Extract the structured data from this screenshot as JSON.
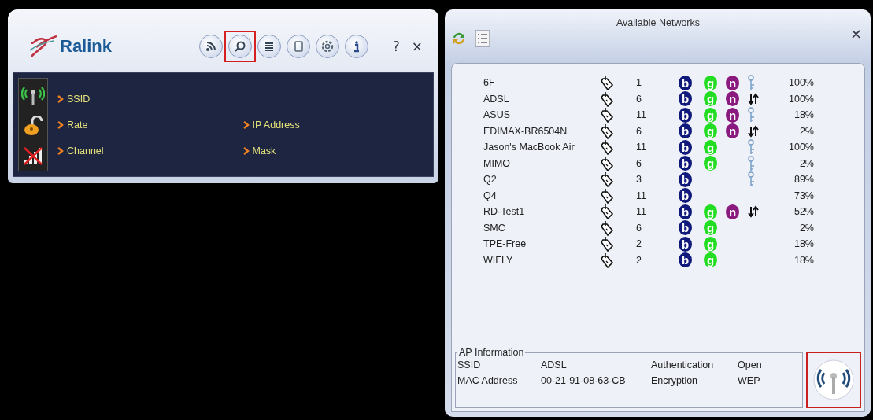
{
  "main_window": {
    "logo": "Ralink",
    "toolbar": [
      {
        "kind": "rss",
        "highlighted": false
      },
      {
        "kind": "search",
        "highlighted": true
      },
      {
        "kind": "list",
        "highlighted": false
      },
      {
        "kind": "page",
        "highlighted": false
      },
      {
        "kind": "gear",
        "highlighted": false
      },
      {
        "kind": "info",
        "highlighted": false
      }
    ],
    "help": "?",
    "close": "×",
    "fields_left": [
      "SSID",
      "Rate",
      "Channel"
    ],
    "fields_right": [
      "IP Address",
      "Mask"
    ]
  },
  "networks_window": {
    "title": "Available Networks",
    "close": "×",
    "networks": [
      {
        "ssid": "6F",
        "channel": "1",
        "modes": [
          {
            "label": "b",
            "color": "#101a7a"
          },
          {
            "label": "g",
            "color": "#22dd22"
          },
          {
            "label": "n",
            "color": "#8a1a7e"
          }
        ],
        "kind": "key",
        "signal": "100%"
      },
      {
        "ssid": "ADSL",
        "channel": "6",
        "modes": [
          {
            "label": "b",
            "color": "#101a7a"
          },
          {
            "label": "g",
            "color": "#22dd22"
          },
          {
            "label": "n",
            "color": "#8a1a7e"
          }
        ],
        "kind": "arrows",
        "signal": "100%"
      },
      {
        "ssid": "ASUS",
        "channel": "11",
        "modes": [
          {
            "label": "b",
            "color": "#101a7a"
          },
          {
            "label": "g",
            "color": "#22dd22"
          },
          {
            "label": "n",
            "color": "#8a1a7e"
          }
        ],
        "kind": "key",
        "signal": "18%"
      },
      {
        "ssid": "EDIMAX-BR6504N",
        "channel": "6",
        "modes": [
          {
            "label": "b",
            "color": "#101a7a"
          },
          {
            "label": "g",
            "color": "#22dd22"
          },
          {
            "label": "n",
            "color": "#8a1a7e"
          }
        ],
        "kind": "arrows",
        "signal": "2%"
      },
      {
        "ssid": "Jason's MacBook Air",
        "channel": "11",
        "modes": [
          {
            "label": "b",
            "color": "#101a7a"
          },
          {
            "label": "g",
            "color": "#22dd22"
          }
        ],
        "kind": "key",
        "signal": "100%"
      },
      {
        "ssid": "MIMO",
        "channel": "6",
        "modes": [
          {
            "label": "b",
            "color": "#101a7a"
          },
          {
            "label": "g",
            "color": "#22dd22"
          }
        ],
        "kind": "key",
        "signal": "2%"
      },
      {
        "ssid": "Q2",
        "channel": "3",
        "modes": [
          {
            "label": "b",
            "color": "#101a7a"
          }
        ],
        "kind": "key",
        "signal": "89%"
      },
      {
        "ssid": "Q4",
        "channel": "11",
        "modes": [
          {
            "label": "b",
            "color": "#101a7a"
          }
        ],
        "signal": "73%"
      },
      {
        "ssid": "RD-Test1",
        "channel": "11",
        "modes": [
          {
            "label": "b",
            "color": "#101a7a"
          },
          {
            "label": "g",
            "color": "#22dd22"
          },
          {
            "label": "n",
            "color": "#8a1a7e"
          }
        ],
        "kind": "arrows",
        "signal": "52%"
      },
      {
        "ssid": "SMC",
        "channel": "6",
        "modes": [
          {
            "label": "b",
            "color": "#101a7a"
          },
          {
            "label": "g",
            "color": "#22dd22"
          }
        ],
        "signal": "2%"
      },
      {
        "ssid": "TPE-Free",
        "channel": "2",
        "modes": [
          {
            "label": "b",
            "color": "#101a7a"
          },
          {
            "label": "g",
            "color": "#22dd22"
          }
        ],
        "signal": "18%"
      },
      {
        "ssid": "WIFLY",
        "channel": "2",
        "modes": [
          {
            "label": "b",
            "color": "#101a7a"
          },
          {
            "label": "g",
            "color": "#22dd22"
          }
        ],
        "signal": "18%"
      }
    ],
    "ap_information": {
      "title": "AP Information",
      "rows": [
        [
          "SSID",
          "ADSL",
          "Authentication",
          "Open"
        ],
        [
          "MAC Address",
          "00-21-91-08-63-CB",
          "Encryption",
          "WEP"
        ]
      ]
    },
    "connect_button": {
      "highlighted": true
    }
  }
}
